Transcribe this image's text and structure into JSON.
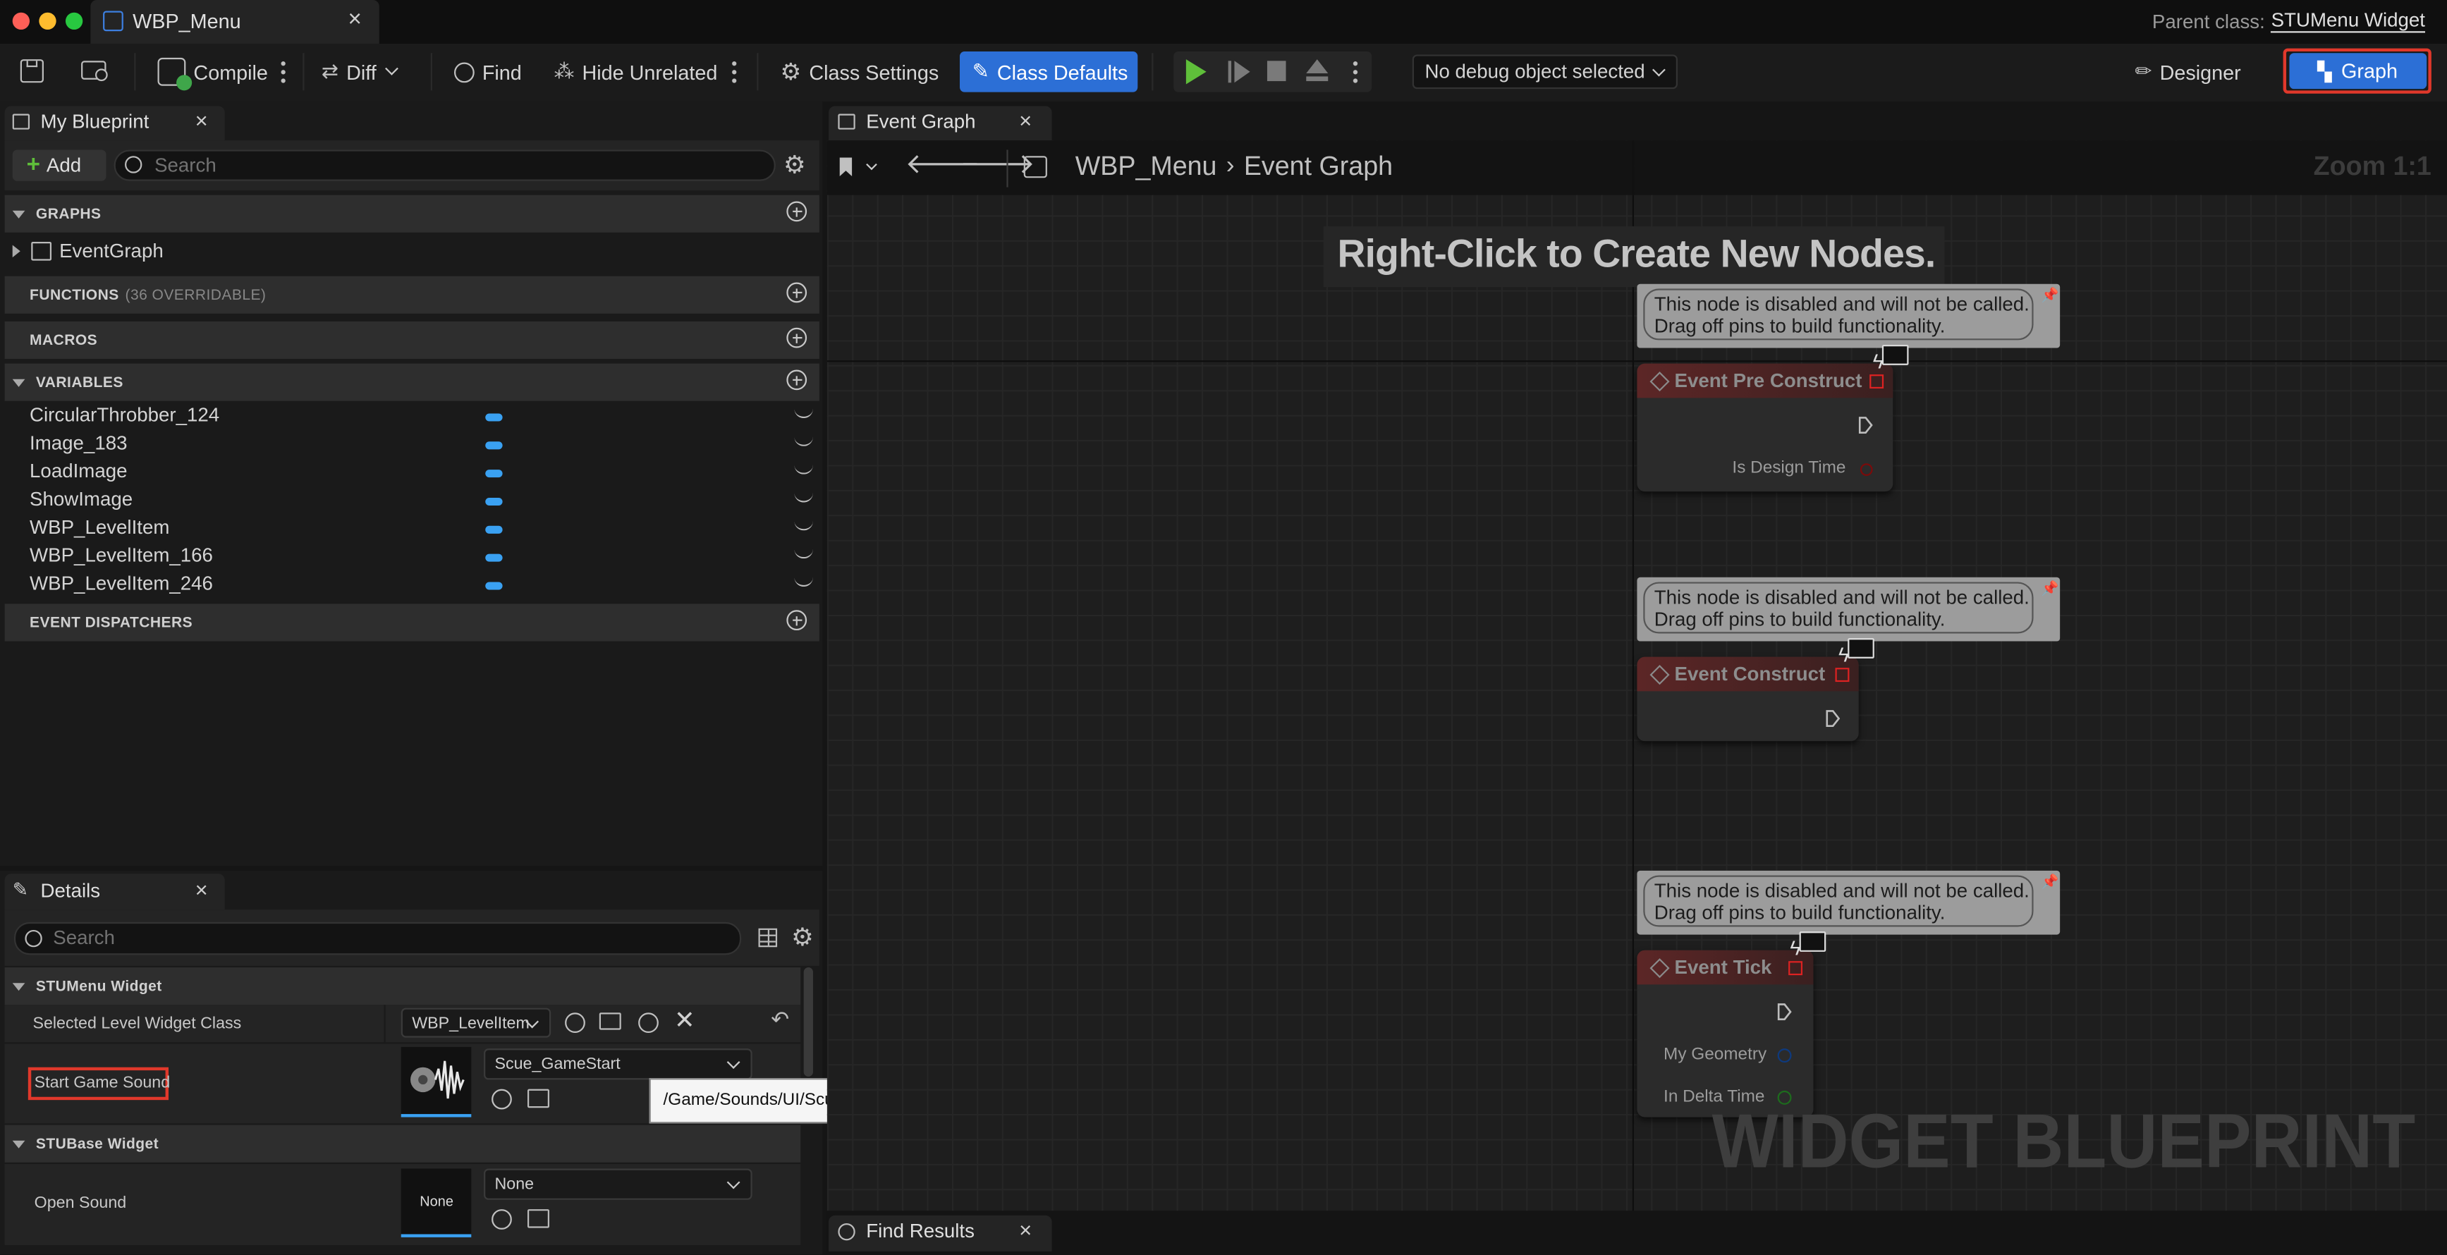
{
  "window": {
    "title": "WBP_Menu",
    "parent_class_label": "Parent class:",
    "parent_class_value": "STUMenu Widget"
  },
  "toolbar": {
    "compile": "Compile",
    "diff": "Diff",
    "find": "Find",
    "hide_unrelated": "Hide Unrelated",
    "class_settings": "Class Settings",
    "class_defaults": "Class Defaults",
    "debug_object": "No debug object selected",
    "designer": "Designer",
    "graph": "Graph"
  },
  "my_blueprint": {
    "tab": "My Blueprint",
    "add": "Add",
    "search_placeholder": "Search",
    "graphs_header": "GRAPHS",
    "event_graph": "EventGraph",
    "functions_header": "FUNCTIONS",
    "functions_sub": "(36 OVERRIDABLE)",
    "macros_header": "MACROS",
    "variables_header": "VARIABLES",
    "variables": [
      "CircularThrobber_124",
      "Image_183",
      "LoadImage",
      "ShowImage",
      "WBP_LevelItem",
      "WBP_LevelItem_166",
      "WBP_LevelItem_246"
    ],
    "dispatchers_header": "EVENT DISPATCHERS"
  },
  "details": {
    "tab": "Details",
    "search_placeholder": "Search",
    "section1": "STUMenu Widget",
    "selected_level_label": "Selected Level Widget Class",
    "selected_level_value": "WBP_LevelItem",
    "start_sound_label": "Start Game Sound",
    "start_sound_value": "Scue_GameStart",
    "tooltip": "/Game/Sounds/UI/Scue_GameStart",
    "section2": "STUBase Widget",
    "open_sound_label": "Open Sound",
    "open_sound_value": "None",
    "open_sound_thumb": "None"
  },
  "graph": {
    "tab": "Event Graph",
    "crumb_root": "WBP_Menu",
    "crumb_current": "Event Graph",
    "zoom": "Zoom 1:1",
    "hint": "Right-Click to Create New Nodes.",
    "disabled_line1": "This node is disabled and will not be called.",
    "disabled_line2": "Drag off pins to build functionality.",
    "node1_title": "Event Pre Construct",
    "node1_pin": "Is Design Time",
    "node2_title": "Event Construct",
    "node3_title": "Event Tick",
    "node3_pin1": "My Geometry",
    "node3_pin2": "In Delta Time",
    "watermark": "WIDGET BLUEPRINT"
  },
  "find_results": {
    "tab": "Find Results"
  },
  "colors": {
    "accent_blue": "#2c6fd6",
    "highlight_red": "#e0382b",
    "play_green": "#5fbf3a",
    "variable_pill": "#3aa1f2"
  }
}
